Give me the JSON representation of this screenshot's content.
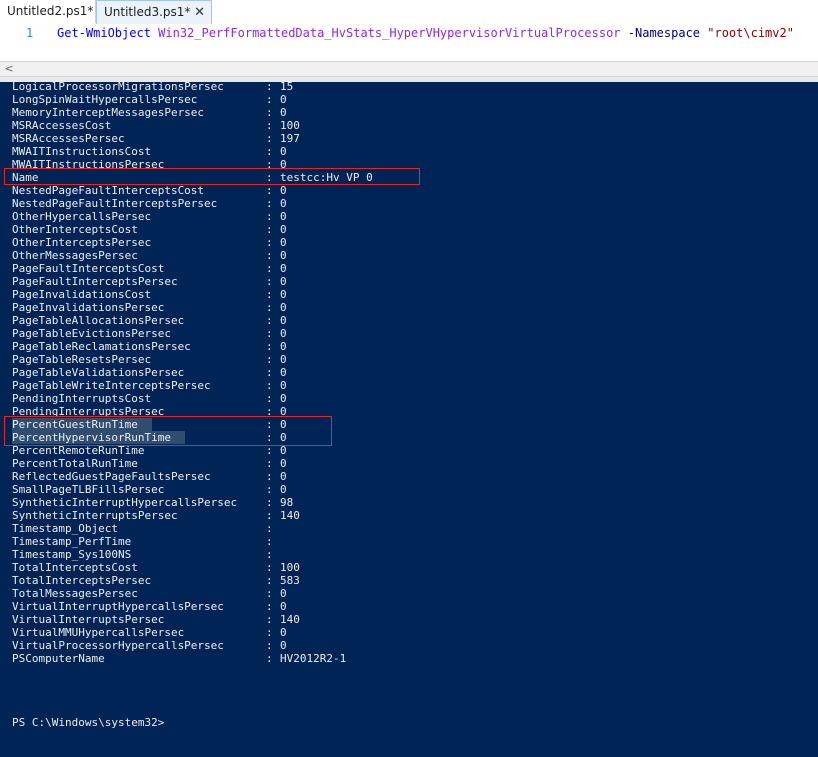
{
  "tabs": [
    {
      "label": "Untitled2.ps1*",
      "active": false
    },
    {
      "label": "Untitled3.ps1*",
      "active": true
    }
  ],
  "tab_close_glyph": "✕",
  "editor": {
    "line_number": "1",
    "cmdlet": "Get-WmiObject",
    "class_name": "Win32_PerfFormattedData_HvStats_HyperVHypervisorVirtualProcessor",
    "param": "-Namespace",
    "namespace": "\"root\\cimv2\""
  },
  "scroll_left_glyph": "<",
  "console": {
    "colors": {
      "background": "#012456",
      "text": "#eeedf0",
      "highlight_box": "#e0282c"
    },
    "properties": [
      {
        "name": "LogicalProcessorMigrationsPersec",
        "value": "15"
      },
      {
        "name": "LongSpinWaitHypercallsPersec",
        "value": "0"
      },
      {
        "name": "MemoryInterceptMessagesPersec",
        "value": "0"
      },
      {
        "name": "MSRAccessesCost",
        "value": "100"
      },
      {
        "name": "MSRAccessesPersec",
        "value": "197"
      },
      {
        "name": "MWAITInstructionsCost",
        "value": "0"
      },
      {
        "name": "MWAITInstructionsPersec",
        "value": "0"
      },
      {
        "name": "Name",
        "value": "testcc:Hv VP 0"
      },
      {
        "name": "NestedPageFaultInterceptsCost",
        "value": "0"
      },
      {
        "name": "NestedPageFaultInterceptsPersec",
        "value": "0"
      },
      {
        "name": "OtherHypercallsPersec",
        "value": "0"
      },
      {
        "name": "OtherInterceptsCost",
        "value": "0"
      },
      {
        "name": "OtherInterceptsPersec",
        "value": "0"
      },
      {
        "name": "OtherMessagesPersec",
        "value": "0"
      },
      {
        "name": "PageFaultInterceptsCost",
        "value": "0"
      },
      {
        "name": "PageFaultInterceptsPersec",
        "value": "0"
      },
      {
        "name": "PageInvalidationsCost",
        "value": "0"
      },
      {
        "name": "PageInvalidationsPersec",
        "value": "0"
      },
      {
        "name": "PageTableAllocationsPersec",
        "value": "0"
      },
      {
        "name": "PageTableEvictionsPersec",
        "value": "0"
      },
      {
        "name": "PageTableReclamationsPersec",
        "value": "0"
      },
      {
        "name": "PageTableResetsPersec",
        "value": "0"
      },
      {
        "name": "PageTableValidationsPersec",
        "value": "0"
      },
      {
        "name": "PageTableWriteInterceptsPersec",
        "value": "0"
      },
      {
        "name": "PendingInterruptsCost",
        "value": "0"
      },
      {
        "name": "PendingInterruptsPersec",
        "value": "0"
      },
      {
        "name": "PercentGuestRunTime",
        "value": "0"
      },
      {
        "name": "PercentHypervisorRunTime",
        "value": "0"
      },
      {
        "name": "PercentRemoteRunTime",
        "value": "0"
      },
      {
        "name": "PercentTotalRunTime",
        "value": "0"
      },
      {
        "name": "ReflectedGuestPageFaultsPersec",
        "value": "0"
      },
      {
        "name": "SmallPageTLBFillsPersec",
        "value": "0"
      },
      {
        "name": "SyntheticInterruptHypercallsPersec",
        "value": "98"
      },
      {
        "name": "SyntheticInterruptsPersec",
        "value": "140"
      },
      {
        "name": "Timestamp_Object",
        "value": ""
      },
      {
        "name": "Timestamp_PerfTime",
        "value": ""
      },
      {
        "name": "Timestamp_Sys100NS",
        "value": ""
      },
      {
        "name": "TotalInterceptsCost",
        "value": "100"
      },
      {
        "name": "TotalInterceptsPersec",
        "value": "583"
      },
      {
        "name": "TotalMessagesPersec",
        "value": "0"
      },
      {
        "name": "VirtualInterruptHypercallsPersec",
        "value": "0"
      },
      {
        "name": "VirtualInterruptsPersec",
        "value": "140"
      },
      {
        "name": "VirtualMMUHypercallsPersec",
        "value": "0"
      },
      {
        "name": "VirtualProcessorHypercallsPersec",
        "value": "0"
      },
      {
        "name": "PSComputerName",
        "value": "HV2012R2-1"
      }
    ],
    "separator": ":",
    "prompt": "PS C:\\Windows\\system32>"
  }
}
